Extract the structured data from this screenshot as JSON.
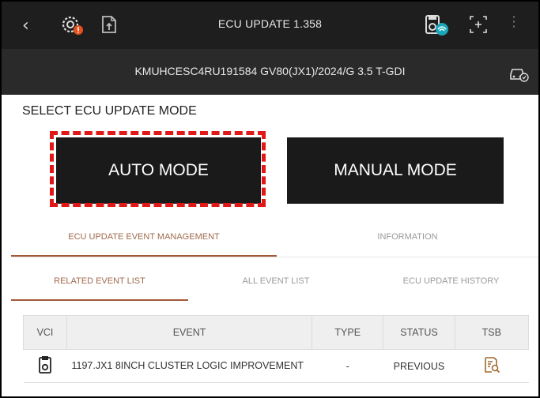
{
  "topbar": {
    "back_glyph": "‹",
    "title": "ECU UPDATE 1.358",
    "icons": [
      "back-icon",
      "gear-alert-icon",
      "document-upload-icon",
      "vci-connected-icon",
      "capture-icon",
      "kebab-menu-icon"
    ],
    "kebab_glyph": "⋮"
  },
  "vehicle": {
    "info": "KMUHCESC4RU191584  GV80(JX1)/2024/G 3.5 T-GDI",
    "icon": "car-status-icon"
  },
  "select": {
    "label": "SELECT ECU UPDATE MODE",
    "auto_label": "AUTO MODE",
    "manual_label": "MANUAL MODE",
    "highlight_color": "#e01818"
  },
  "tabs": {
    "primary": [
      {
        "label": "ECU UPDATE EVENT MANAGEMENT",
        "active": true
      },
      {
        "label": "INFORMATION",
        "active": false
      }
    ],
    "secondary": [
      {
        "label": "RELATED EVENT LIST",
        "active": true
      },
      {
        "label": "ALL EVENT LIST",
        "active": false
      },
      {
        "label": "ECU UPDATE HISTORY",
        "active": false
      }
    ],
    "accent_color": "#a05a3a"
  },
  "table": {
    "headers": [
      "VCI",
      "EVENT",
      "TYPE",
      "STATUS",
      "TSB"
    ],
    "rows": [
      {
        "vci_icon": "vci-device-icon",
        "event": "1197.JX1 8INCH CLUSTER LOGIC IMPROVEMENT",
        "type": "-",
        "status": "PREVIOUS",
        "tsb_icon": "tsb-document-search-icon"
      }
    ]
  }
}
